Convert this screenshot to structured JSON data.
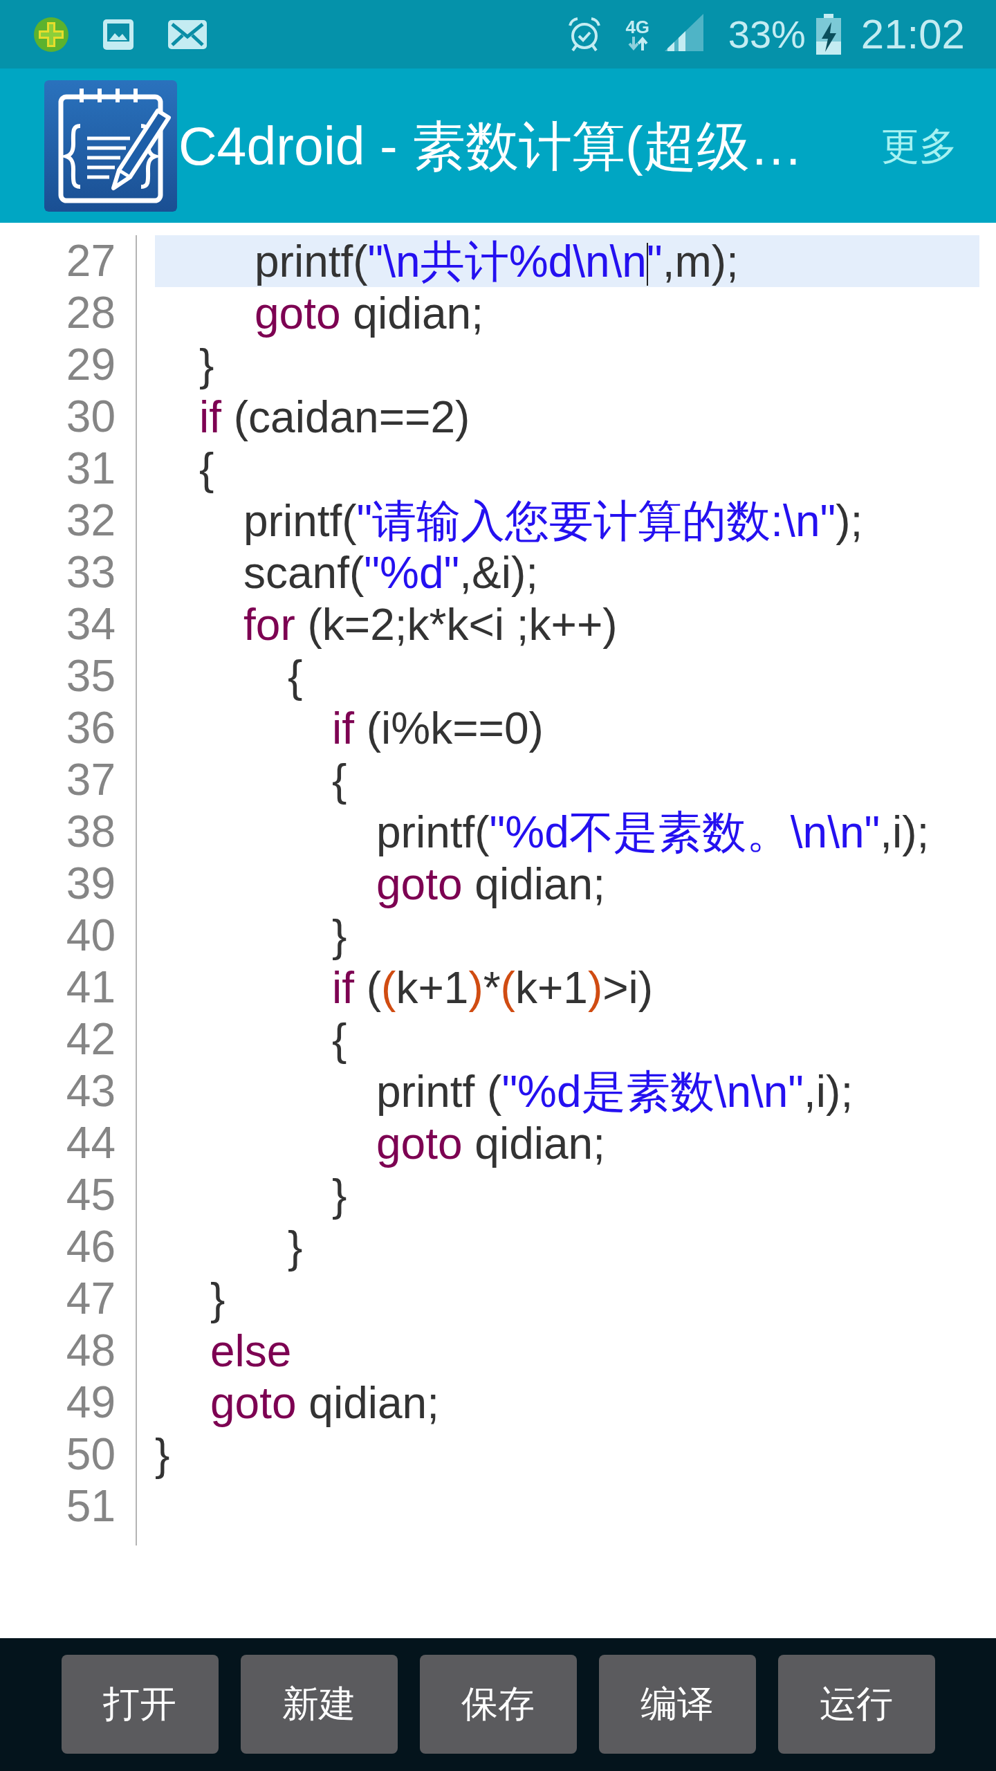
{
  "status_bar": {
    "network_type": "4G",
    "battery": "33%",
    "time": "21:02"
  },
  "app_bar": {
    "title": "C4droid - 素数计算(超级…",
    "menu": "更多"
  },
  "editor": {
    "lines": [
      {
        "number": "27",
        "selected": true,
        "tokens": [
          {
            "kind": "plain",
            "text": "         printf("
          },
          {
            "kind": "string",
            "text": "\"\\n共计%d\\n\\n"
          },
          {
            "kind": "cursor"
          },
          {
            "kind": "string",
            "text": "\""
          },
          {
            "kind": "plain",
            "text": ",m);"
          }
        ]
      },
      {
        "number": "28",
        "selected": false,
        "tokens": [
          {
            "kind": "keyword",
            "text": "         goto"
          },
          {
            "kind": "plain",
            "text": " qidian;"
          }
        ]
      },
      {
        "number": "29",
        "selected": false,
        "tokens": [
          {
            "kind": "plain",
            "text": "    }"
          }
        ]
      },
      {
        "number": "30",
        "selected": false,
        "tokens": [
          {
            "kind": "keyword",
            "text": "    if"
          },
          {
            "kind": "plain",
            "text": " (caidan==2)"
          }
        ]
      },
      {
        "number": "31",
        "selected": false,
        "tokens": [
          {
            "kind": "plain",
            "text": "    {"
          }
        ]
      },
      {
        "number": "32",
        "selected": false,
        "tokens": [
          {
            "kind": "plain",
            "text": "        printf("
          },
          {
            "kind": "string",
            "text": "\"请输入您要计算的数:\\n\""
          },
          {
            "kind": "plain",
            "text": ");"
          }
        ]
      },
      {
        "number": "33",
        "selected": false,
        "tokens": [
          {
            "kind": "plain",
            "text": "        scanf("
          },
          {
            "kind": "string",
            "text": "\"%d\""
          },
          {
            "kind": "plain",
            "text": ",&i);"
          }
        ]
      },
      {
        "number": "34",
        "selected": false,
        "tokens": [
          {
            "kind": "keyword",
            "text": "        for"
          },
          {
            "kind": "plain",
            "text": " (k=2;k*k<i ;k++)"
          }
        ]
      },
      {
        "number": "35",
        "selected": false,
        "tokens": [
          {
            "kind": "plain",
            "text": "            {"
          }
        ]
      },
      {
        "number": "36",
        "selected": false,
        "tokens": [
          {
            "kind": "keyword",
            "text": "                if"
          },
          {
            "kind": "plain",
            "text": " (i%k==0)"
          }
        ]
      },
      {
        "number": "37",
        "selected": false,
        "tokens": [
          {
            "kind": "plain",
            "text": "                {"
          }
        ]
      },
      {
        "number": "38",
        "selected": false,
        "tokens": [
          {
            "kind": "plain",
            "text": "                    printf("
          },
          {
            "kind": "string",
            "text": "\"%d不是素数。\\n\\n\""
          },
          {
            "kind": "plain",
            "text": ",i);"
          }
        ]
      },
      {
        "number": "39",
        "selected": false,
        "tokens": [
          {
            "kind": "keyword",
            "text": "                    goto"
          },
          {
            "kind": "plain",
            "text": " qidian;"
          }
        ]
      },
      {
        "number": "40",
        "selected": false,
        "tokens": [
          {
            "kind": "plain",
            "text": "                }"
          }
        ]
      },
      {
        "number": "41",
        "selected": false,
        "tokens": [
          {
            "kind": "keyword",
            "text": "                if"
          },
          {
            "kind": "plain",
            "text": " ("
          },
          {
            "kind": "bracket",
            "text": "("
          },
          {
            "kind": "plain",
            "text": "k+1"
          },
          {
            "kind": "bracket",
            "text": ")"
          },
          {
            "kind": "plain",
            "text": "*"
          },
          {
            "kind": "bracket",
            "text": "("
          },
          {
            "kind": "plain",
            "text": "k+1"
          },
          {
            "kind": "bracket",
            "text": ")"
          },
          {
            "kind": "plain",
            "text": ">i)"
          }
        ]
      },
      {
        "number": "42",
        "selected": false,
        "tokens": [
          {
            "kind": "plain",
            "text": "                {"
          }
        ]
      },
      {
        "number": "43",
        "selected": false,
        "tokens": [
          {
            "kind": "plain",
            "text": "                    printf ("
          },
          {
            "kind": "string",
            "text": "\"%d是素数\\n\\n\""
          },
          {
            "kind": "plain",
            "text": ",i);"
          }
        ]
      },
      {
        "number": "44",
        "selected": false,
        "tokens": [
          {
            "kind": "keyword",
            "text": "                    goto"
          },
          {
            "kind": "plain",
            "text": " qidian;"
          }
        ]
      },
      {
        "number": "45",
        "selected": false,
        "tokens": [
          {
            "kind": "plain",
            "text": "                }"
          }
        ]
      },
      {
        "number": "46",
        "selected": false,
        "tokens": [
          {
            "kind": "plain",
            "text": "            }"
          }
        ]
      },
      {
        "number": "47",
        "selected": false,
        "tokens": [
          {
            "kind": "plain",
            "text": "     }"
          }
        ]
      },
      {
        "number": "48",
        "selected": false,
        "tokens": [
          {
            "kind": "keyword",
            "text": "     else"
          }
        ]
      },
      {
        "number": "49",
        "selected": false,
        "tokens": [
          {
            "kind": "keyword",
            "text": "     goto"
          },
          {
            "kind": "plain",
            "text": " qidian;"
          }
        ]
      },
      {
        "number": "50",
        "selected": false,
        "tokens": [
          {
            "kind": "plain",
            "text": "}"
          }
        ]
      },
      {
        "number": "51",
        "selected": false
      }
    ]
  },
  "toolbar": {
    "buttons": [
      "打开",
      "新建",
      "保存",
      "编译",
      "运行"
    ]
  }
}
